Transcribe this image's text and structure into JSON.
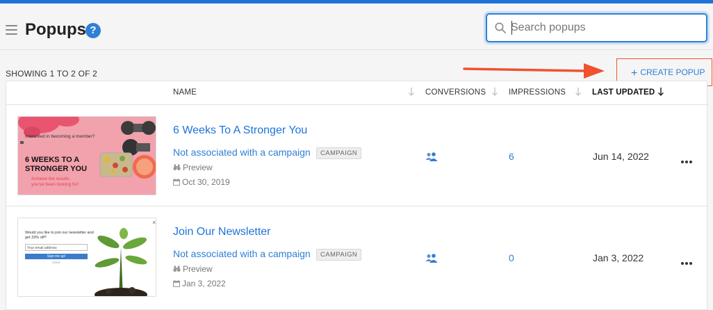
{
  "header": {
    "title": "Popups",
    "help_icon": "?",
    "search": {
      "placeholder": "Search popups",
      "value": ""
    }
  },
  "toolbar": {
    "showing": "SHOWING 1 TO 2 OF 2",
    "create_label": "CREATE POPUP",
    "create_plus": "+"
  },
  "columns": {
    "name": "NAME",
    "conversions": "CONVERSIONS",
    "impressions": "IMPRESSIONS",
    "last_updated": "LAST UPDATED"
  },
  "rows": [
    {
      "name": "6 Weeks To A Stronger You",
      "association": "Not associated with a campaign",
      "badge": "CAMPAIGN",
      "preview": "Preview",
      "created": "Oct 30, 2019",
      "impressions": "6",
      "last_updated": "Jun 14, 2022",
      "thumb": {
        "small_text": "Interested in becoming a member?",
        "headline_1": "6 WEEKS TO A",
        "headline_2": "STRONGER YOU",
        "sub_1": "Achieve the results",
        "sub_2": "you've been looking for!"
      }
    },
    {
      "name": "Join Our Newsletter",
      "association": "Not associated with a campaign",
      "badge": "CAMPAIGN",
      "preview": "Preview",
      "created": "Jan 3, 2022",
      "impressions": "0",
      "last_updated": "Jan 3, 2022",
      "thumb": {
        "text_1": "Would you like to join our newsletter and",
        "text_2": "get 33% off?",
        "email_placeholder": "Your email address",
        "button": "Sign me up!",
        "close_link": "Close",
        "close_x": "×"
      }
    }
  ],
  "colors": {
    "accent": "#1e73d8",
    "highlight": "#f0522f"
  },
  "icons": [
    "hamburger-icon",
    "help-icon",
    "search-icon",
    "sort-arrow-icon",
    "plus-icon",
    "users-icon",
    "binoculars-icon",
    "calendar-icon",
    "more-icon"
  ]
}
